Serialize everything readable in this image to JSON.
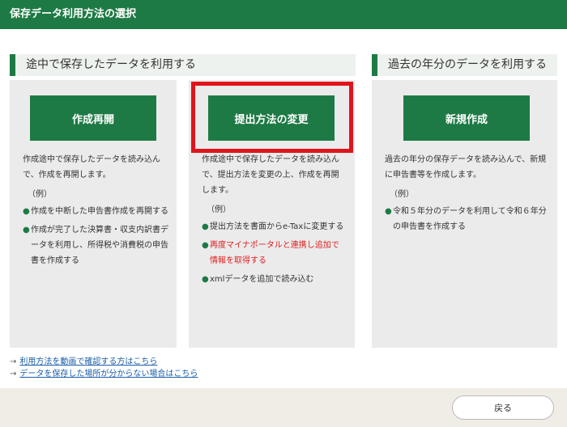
{
  "header": {
    "title": "保存データ利用方法の選択"
  },
  "sections": {
    "left_title": "途中で保存したデータを利用する",
    "right_title": "過去の年分のデータを利用する"
  },
  "panels": [
    {
      "button": "作成再開",
      "desc": "作成途中で保存したデータを読み込んで、作成を再開します。",
      "example_label": "（例）",
      "examples": [
        "作成を中断した申告書作成を再開する",
        "作成が完了した決算書・収支内訳書データを利用し、所得税や消費税の申告書を作成する"
      ]
    },
    {
      "button": "提出方法の変更",
      "desc": "作成途中で保存したデータを読み込んで、提出方法を変更の上、作成を再開します。",
      "example_label": "（例）",
      "examples": [
        "提出方法を書面からe-Taxに変更する",
        "再度マイナポータルと連携し追加で情報を取得する",
        "xmlデータを追加で読み込む"
      ]
    },
    {
      "button": "新規作成",
      "desc": "過去の年分の保存データを読み込んで、新規に申告書等を作成します。",
      "example_label": "（例）",
      "examples": [
        "令和５年分のデータを利用して令和６年分の申告書を作成する"
      ]
    }
  ],
  "links": [
    "利用方法を動画で確認する方はこちら",
    "データを保存した場所が分からない場合はこちら"
  ],
  "footer": {
    "back": "戻る"
  },
  "colors": {
    "green": "#1e7a45",
    "highlight_red": "#e0141c",
    "warning_red": "#e02020",
    "link_blue": "#1b5ea8"
  }
}
